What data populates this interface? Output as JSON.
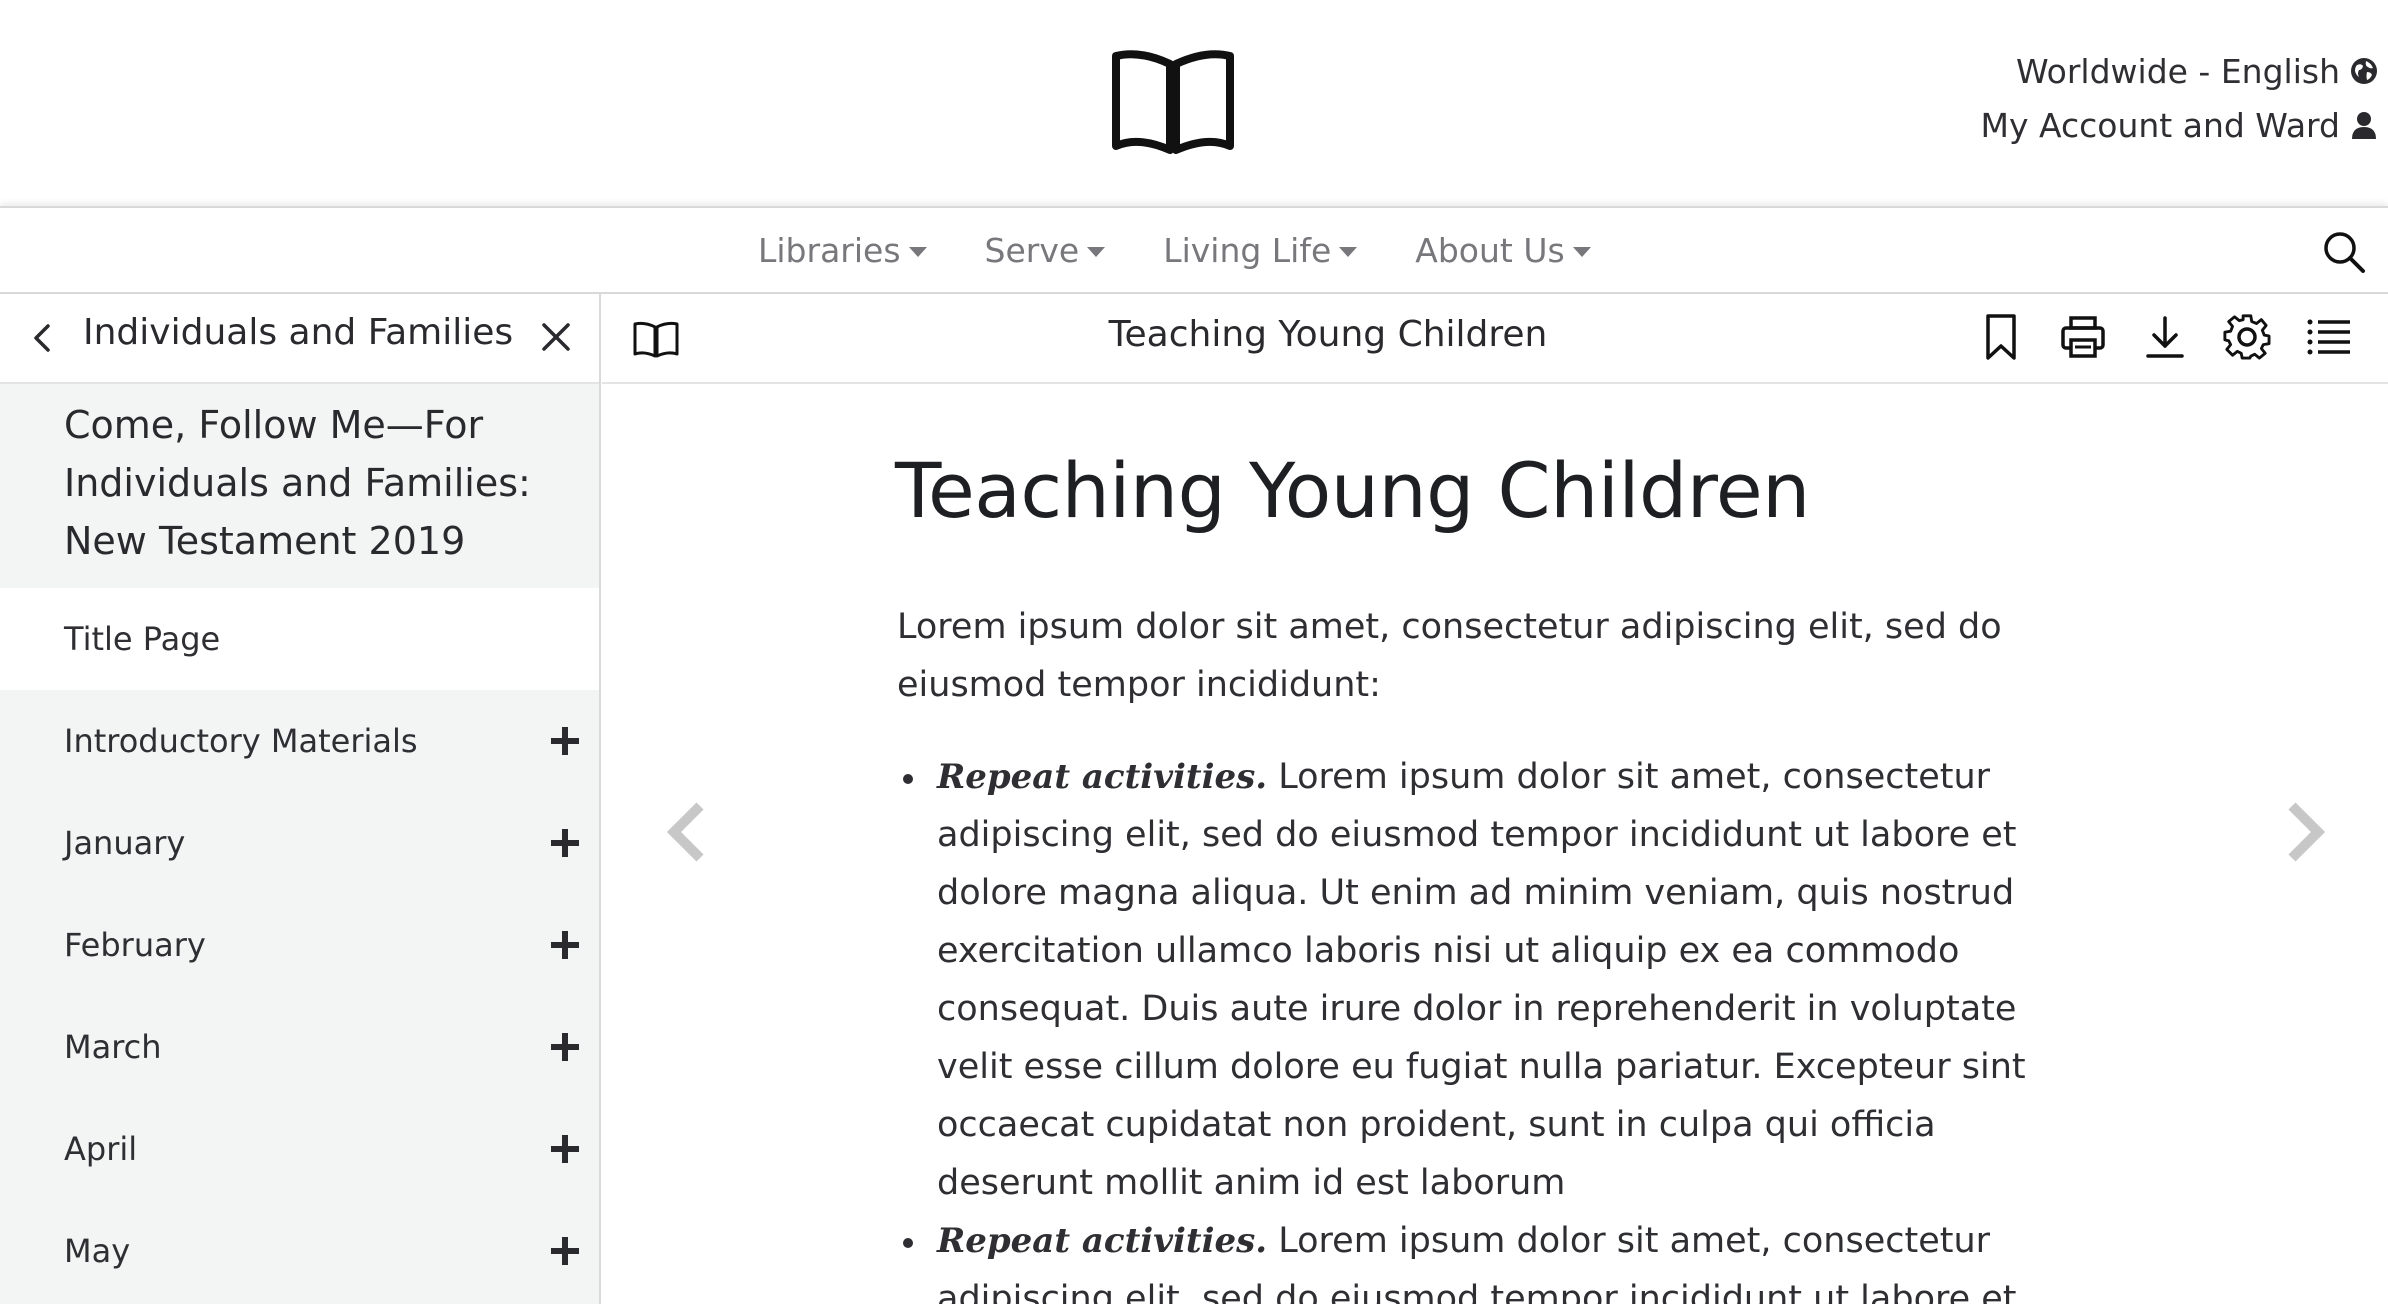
{
  "header": {
    "logo_icon": "open-book-icon",
    "locale_label": "Worldwide - English",
    "locale_icon": "globe-icon",
    "account_label": "My Account and Ward",
    "account_icon": "user-icon"
  },
  "nav": {
    "items": [
      {
        "label": "Libraries"
      },
      {
        "label": "Serve"
      },
      {
        "label": "Living Life"
      },
      {
        "label": "About Us"
      }
    ],
    "search_icon": "search-icon"
  },
  "sidebar": {
    "title": "Individuals and Families",
    "book_title": "Come, Follow Me—For Individuals and Families: New Testament 2019",
    "items": [
      {
        "label": "Title Page",
        "active": true
      },
      {
        "label": "Introductory Materials"
      },
      {
        "label": "January"
      },
      {
        "label": "February"
      },
      {
        "label": "March"
      },
      {
        "label": "April"
      },
      {
        "label": "May"
      }
    ]
  },
  "toolbar": {
    "title": "Teaching Young Children",
    "icons": [
      "bookmark-icon",
      "print-icon",
      "download-icon",
      "settings-icon",
      "list-icon"
    ]
  },
  "content": {
    "title": "Teaching Young Children",
    "intro": "Lorem ipsum dolor sit amet, consectetur adipiscing elit, sed do eiusmod tempor incididunt:",
    "bullets": [
      {
        "lead": "Repeat activities.",
        "text": " Lorem ipsum dolor sit amet, consectetur adipiscing elit, sed do eiusmod tempor incididunt ut labore et dolore magna aliqua. Ut enim ad minim veniam, quis nostrud exercitation ullamco laboris nisi ut aliquip ex ea commodo consequat. Duis aute irure dolor in reprehenderit in voluptate velit esse cillum dolore eu fugiat nulla pariatur. Excepteur sint occaecat cupidatat non proident, sunt in culpa qui officia deserunt mollit anim id est laborum"
      },
      {
        "lead": "Repeat activities.",
        "text": " Lorem ipsum dolor sit amet, consectetur adipiscing elit, sed do eiusmod tempor incididunt ut labore et"
      }
    ]
  }
}
